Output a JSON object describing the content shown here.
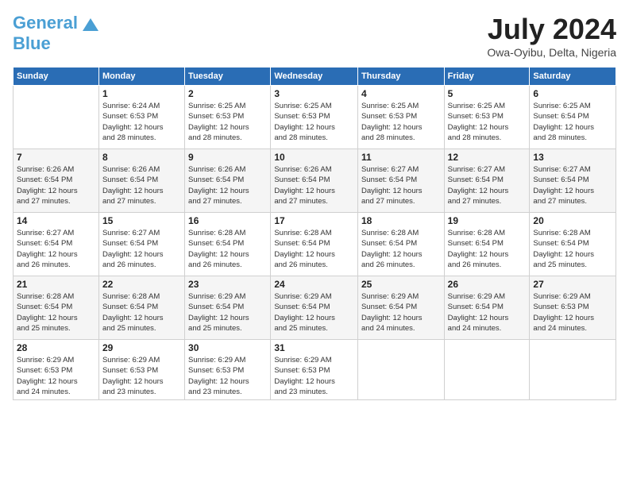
{
  "header": {
    "logo_main": "General",
    "logo_sub": "Blue",
    "month_year": "July 2024",
    "location": "Owa-Oyibu, Delta, Nigeria"
  },
  "days_of_week": [
    "Sunday",
    "Monday",
    "Tuesday",
    "Wednesday",
    "Thursday",
    "Friday",
    "Saturday"
  ],
  "weeks": [
    [
      {
        "day": "",
        "info": ""
      },
      {
        "day": "1",
        "info": "Sunrise: 6:24 AM\nSunset: 6:53 PM\nDaylight: 12 hours\nand 28 minutes."
      },
      {
        "day": "2",
        "info": "Sunrise: 6:25 AM\nSunset: 6:53 PM\nDaylight: 12 hours\nand 28 minutes."
      },
      {
        "day": "3",
        "info": "Sunrise: 6:25 AM\nSunset: 6:53 PM\nDaylight: 12 hours\nand 28 minutes."
      },
      {
        "day": "4",
        "info": "Sunrise: 6:25 AM\nSunset: 6:53 PM\nDaylight: 12 hours\nand 28 minutes."
      },
      {
        "day": "5",
        "info": "Sunrise: 6:25 AM\nSunset: 6:53 PM\nDaylight: 12 hours\nand 28 minutes."
      },
      {
        "day": "6",
        "info": "Sunrise: 6:25 AM\nSunset: 6:54 PM\nDaylight: 12 hours\nand 28 minutes."
      }
    ],
    [
      {
        "day": "7",
        "info": "Sunrise: 6:26 AM\nSunset: 6:54 PM\nDaylight: 12 hours\nand 27 minutes."
      },
      {
        "day": "8",
        "info": "Sunrise: 6:26 AM\nSunset: 6:54 PM\nDaylight: 12 hours\nand 27 minutes."
      },
      {
        "day": "9",
        "info": "Sunrise: 6:26 AM\nSunset: 6:54 PM\nDaylight: 12 hours\nand 27 minutes."
      },
      {
        "day": "10",
        "info": "Sunrise: 6:26 AM\nSunset: 6:54 PM\nDaylight: 12 hours\nand 27 minutes."
      },
      {
        "day": "11",
        "info": "Sunrise: 6:27 AM\nSunset: 6:54 PM\nDaylight: 12 hours\nand 27 minutes."
      },
      {
        "day": "12",
        "info": "Sunrise: 6:27 AM\nSunset: 6:54 PM\nDaylight: 12 hours\nand 27 minutes."
      },
      {
        "day": "13",
        "info": "Sunrise: 6:27 AM\nSunset: 6:54 PM\nDaylight: 12 hours\nand 27 minutes."
      }
    ],
    [
      {
        "day": "14",
        "info": "Sunrise: 6:27 AM\nSunset: 6:54 PM\nDaylight: 12 hours\nand 26 minutes."
      },
      {
        "day": "15",
        "info": "Sunrise: 6:27 AM\nSunset: 6:54 PM\nDaylight: 12 hours\nand 26 minutes."
      },
      {
        "day": "16",
        "info": "Sunrise: 6:28 AM\nSunset: 6:54 PM\nDaylight: 12 hours\nand 26 minutes."
      },
      {
        "day": "17",
        "info": "Sunrise: 6:28 AM\nSunset: 6:54 PM\nDaylight: 12 hours\nand 26 minutes."
      },
      {
        "day": "18",
        "info": "Sunrise: 6:28 AM\nSunset: 6:54 PM\nDaylight: 12 hours\nand 26 minutes."
      },
      {
        "day": "19",
        "info": "Sunrise: 6:28 AM\nSunset: 6:54 PM\nDaylight: 12 hours\nand 26 minutes."
      },
      {
        "day": "20",
        "info": "Sunrise: 6:28 AM\nSunset: 6:54 PM\nDaylight: 12 hours\nand 25 minutes."
      }
    ],
    [
      {
        "day": "21",
        "info": "Sunrise: 6:28 AM\nSunset: 6:54 PM\nDaylight: 12 hours\nand 25 minutes."
      },
      {
        "day": "22",
        "info": "Sunrise: 6:28 AM\nSunset: 6:54 PM\nDaylight: 12 hours\nand 25 minutes."
      },
      {
        "day": "23",
        "info": "Sunrise: 6:29 AM\nSunset: 6:54 PM\nDaylight: 12 hours\nand 25 minutes."
      },
      {
        "day": "24",
        "info": "Sunrise: 6:29 AM\nSunset: 6:54 PM\nDaylight: 12 hours\nand 25 minutes."
      },
      {
        "day": "25",
        "info": "Sunrise: 6:29 AM\nSunset: 6:54 PM\nDaylight: 12 hours\nand 24 minutes."
      },
      {
        "day": "26",
        "info": "Sunrise: 6:29 AM\nSunset: 6:54 PM\nDaylight: 12 hours\nand 24 minutes."
      },
      {
        "day": "27",
        "info": "Sunrise: 6:29 AM\nSunset: 6:53 PM\nDaylight: 12 hours\nand 24 minutes."
      }
    ],
    [
      {
        "day": "28",
        "info": "Sunrise: 6:29 AM\nSunset: 6:53 PM\nDaylight: 12 hours\nand 24 minutes."
      },
      {
        "day": "29",
        "info": "Sunrise: 6:29 AM\nSunset: 6:53 PM\nDaylight: 12 hours\nand 23 minutes."
      },
      {
        "day": "30",
        "info": "Sunrise: 6:29 AM\nSunset: 6:53 PM\nDaylight: 12 hours\nand 23 minutes."
      },
      {
        "day": "31",
        "info": "Sunrise: 6:29 AM\nSunset: 6:53 PM\nDaylight: 12 hours\nand 23 minutes."
      },
      {
        "day": "",
        "info": ""
      },
      {
        "day": "",
        "info": ""
      },
      {
        "day": "",
        "info": ""
      }
    ]
  ]
}
